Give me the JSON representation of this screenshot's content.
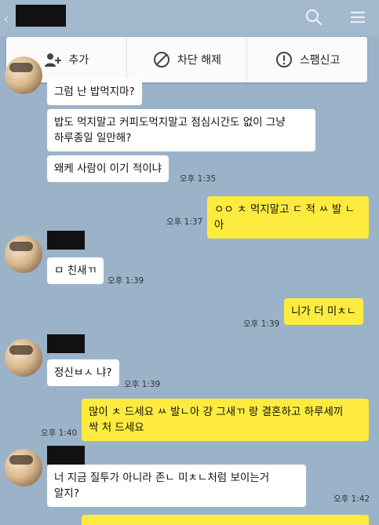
{
  "header": {
    "back_glyph": "‹"
  },
  "actions": [
    {
      "label": "추가",
      "icon": "add-friend-icon"
    },
    {
      "label": "차단 해제",
      "icon": "unblock-icon"
    },
    {
      "label": "스팸신고",
      "icon": "spam-report-icon"
    }
  ],
  "messages": [
    {
      "text": "그럼 난 밥먹지마?",
      "time": ""
    },
    {
      "text": "밥도 먹지말고 커피도먹지말고 점심시간도 없이 그냥\n하루종일 일만해?",
      "time": ""
    },
    {
      "text": "왜케 사람이 이기 적이냐",
      "time": "오후 1:35"
    },
    {
      "text": "ㅇㅇ ㅊ 먹지말고 ㄷ 적 ㅆ 발 ㄴ 아",
      "time": "오후 1:37"
    },
    {
      "text": "ㅁ 친새ㄲ",
      "time": "오후 1:39"
    },
    {
      "text": "니가 더 미ㅊㄴ",
      "time": "오후 1:39"
    },
    {
      "text": "정신ㅂㅅ 냐?",
      "time": "오후 1:39"
    },
    {
      "text": "많이 ㅊ 드세요 ㅆ 발ㄴ아 걍 그새ㄲ 랑 결혼하고 하루세끼\n싹 처 드세요",
      "time": "오후 1:40"
    },
    {
      "text": "너 지금 질투가 아니라 존ㄴ 미ㅊㄴ처럼 보이는거\n알지?",
      "time": "오후 1:42"
    }
  ],
  "colors": {
    "background": "#9bb3c9",
    "incoming_bubble": "#ffffff",
    "outgoing_bubble": "#fdec3f"
  }
}
